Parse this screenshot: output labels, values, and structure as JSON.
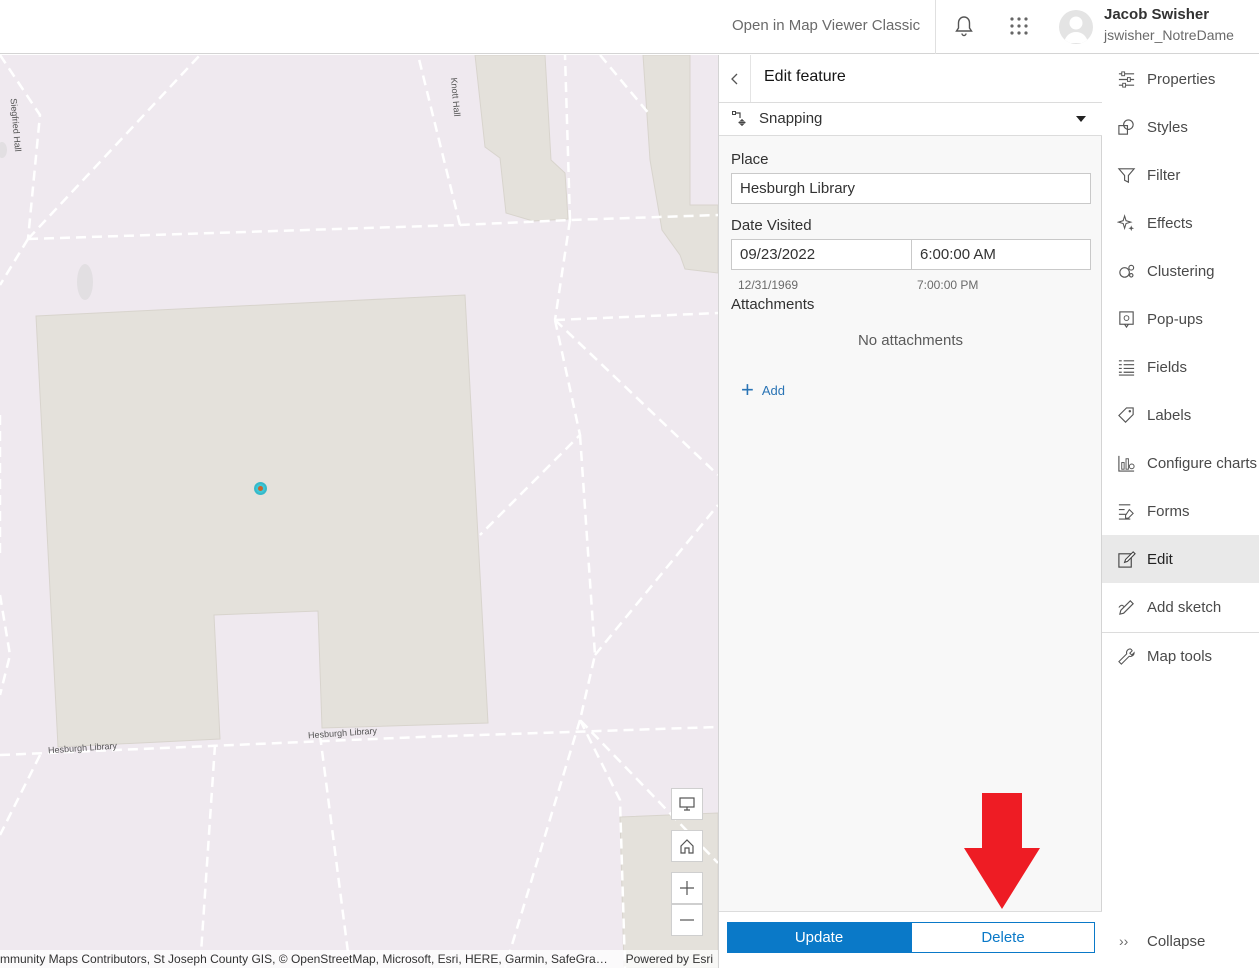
{
  "header": {
    "open_classic": "Open in Map Viewer Classic",
    "user_name": "Jacob Swisher",
    "user_id": "jswisher_NotreDame"
  },
  "map": {
    "labels": {
      "siegfried": "Siegfried Hall",
      "knott": "Knott Hall",
      "hesburgh_left": "Hesburgh Library",
      "hesburgh_right": "Hesburgh Library"
    },
    "attribution": "mmunity Maps Contributors, St Joseph County GIS, © OpenStreetMap, Microsoft, Esri, HERE, Garmin, SafeGrap…",
    "powered_by": "Powered by Esri",
    "colors": {
      "background": "#efe9ef",
      "building": "#e4e1db",
      "road": "#ffffff",
      "marker": "#3ec8d8"
    }
  },
  "panel": {
    "title": "Edit feature",
    "snapping": "Snapping",
    "place_label": "Place",
    "place_value": "Hesburgh Library",
    "date_label": "Date Visited",
    "date_value": "09/23/2022",
    "time_value": "6:00:00 AM",
    "date_min": "12/31/1969",
    "time_min": "7:00:00 PM",
    "attachments_label": "Attachments",
    "no_attachments": "No attachments",
    "add_label": "Add",
    "update_label": "Update",
    "delete_label": "Delete",
    "accent": "#0a79c8"
  },
  "tools": {
    "items": [
      {
        "label": "Properties",
        "icon": "properties-icon"
      },
      {
        "label": "Styles",
        "icon": "styles-icon"
      },
      {
        "label": "Filter",
        "icon": "filter-icon"
      },
      {
        "label": "Effects",
        "icon": "effects-icon"
      },
      {
        "label": "Clustering",
        "icon": "clustering-icon"
      },
      {
        "label": "Pop-ups",
        "icon": "popups-icon"
      },
      {
        "label": "Fields",
        "icon": "fields-icon"
      },
      {
        "label": "Labels",
        "icon": "labels-icon"
      },
      {
        "label": "Configure charts",
        "icon": "charts-icon"
      },
      {
        "label": "Forms",
        "icon": "forms-icon"
      },
      {
        "label": "Edit",
        "icon": "edit-icon",
        "active": true
      },
      {
        "label": "Add sketch",
        "icon": "sketch-icon"
      },
      {
        "label": "Map tools",
        "icon": "wrench-icon"
      }
    ],
    "collapse": "Collapse"
  },
  "annotation": {
    "arrow_color": "#ee1c24"
  }
}
